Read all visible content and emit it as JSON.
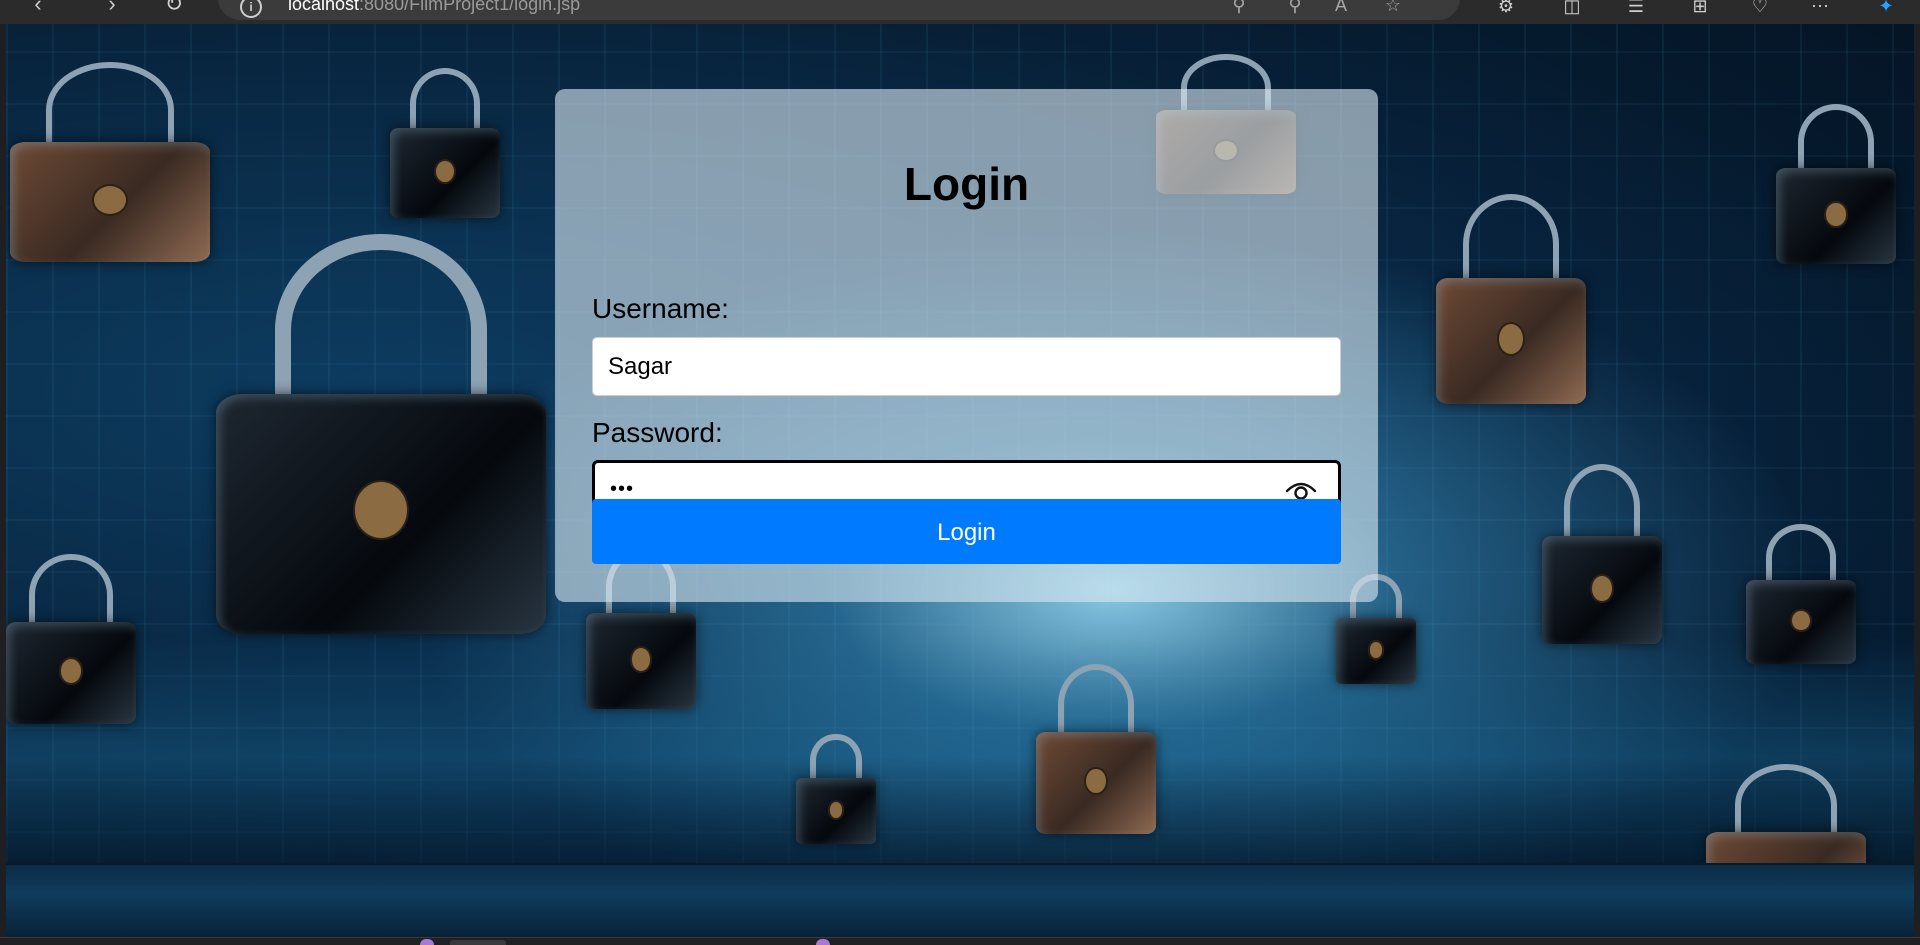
{
  "browser": {
    "url_host": "localhost",
    "url_rest": ":8080/FilmProject1/login.jsp",
    "back_icon": "back-arrow-icon",
    "forward_icon": "forward-arrow-icon",
    "refresh_icon": "refresh-icon",
    "site_info_icon": "info-icon"
  },
  "login": {
    "title": "Login",
    "username_label": "Username:",
    "username_value": "Sagar",
    "password_label": "Password:",
    "password_masked": "•••",
    "button_label": "Login"
  },
  "colors": {
    "button": "#007bff",
    "card_background": "rgba(214,230,240,0.62)"
  }
}
